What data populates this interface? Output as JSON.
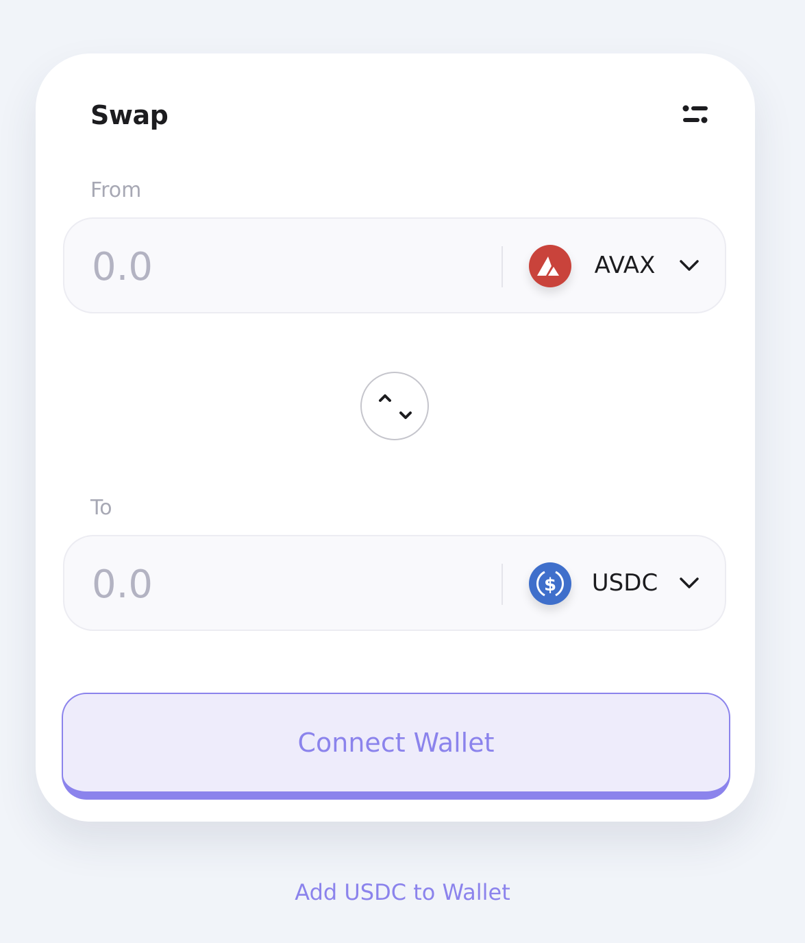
{
  "swap": {
    "title": "Swap",
    "settings_icon": "sliders-icon",
    "from": {
      "label": "From",
      "amount_placeholder": "0.0",
      "amount_value": "",
      "token": {
        "symbol": "AVAX",
        "icon": "avax-logo",
        "color": "#e84142"
      }
    },
    "switch_icon": "swap-direction-icon",
    "to": {
      "label": "To",
      "amount_placeholder": "0.0",
      "amount_value": "",
      "token": {
        "symbol": "USDC",
        "icon": "usdc-logo",
        "color": "#2775ca"
      }
    },
    "connect_button_label": "Connect Wallet"
  },
  "footer": {
    "add_token_label": "Add USDC to Wallet"
  },
  "colors": {
    "background": "#f1f4f9",
    "card": "#ffffff",
    "accent": "#8b83ec",
    "accent_soft": "#eeecfb"
  }
}
